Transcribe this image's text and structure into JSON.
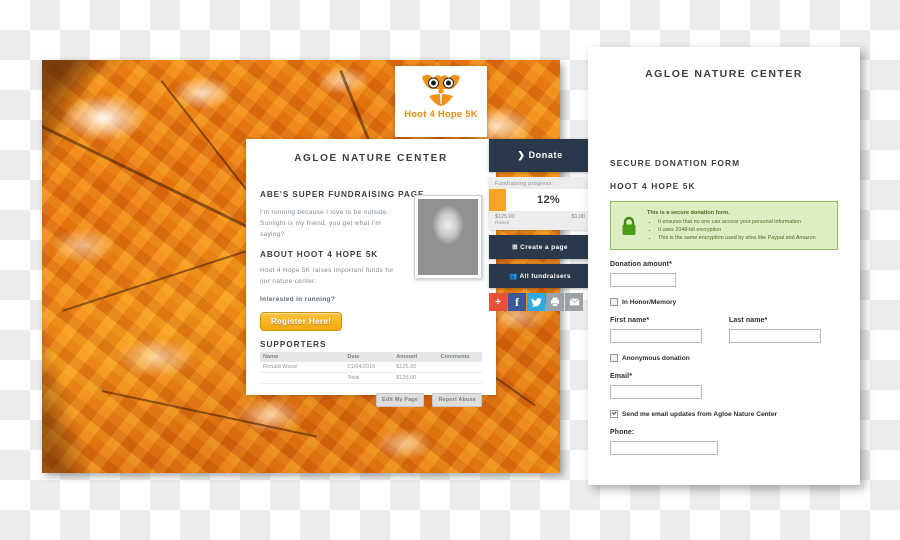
{
  "photo": {
    "alt": "autumn-maple-leaves-photo"
  },
  "logo": {
    "text": "Hoot 4 Hope 5K",
    "icon": "owl-icon"
  },
  "page": {
    "org_title": "AGLOE NATURE CENTER",
    "fundraiser_title": "ABE'S SUPER FUNDRAISING PAGE",
    "bio": "I'm running because I love to be outside. Sunlight is my friend, you get what I'm saying?",
    "about_title": "ABOUT HOOT 4 HOPE 5K",
    "about_body": "Hoot 4 Hope 5K raises important funds for our nature center.",
    "interested": "Interested in running?",
    "register_label": "Register Here!",
    "supporters_title": "SUPPORTERS",
    "supporters_columns": [
      "Name",
      "Date",
      "Amount",
      "Comments"
    ],
    "supporters_rows": [
      {
        "name": "Ronald Wood",
        "date": "01/04/2016",
        "amount": "$125.00",
        "comments": ""
      }
    ],
    "total_row": {
      "name": "",
      "date": "Total",
      "amount": "$125.00",
      "comments": ""
    },
    "edit_label": "Edit My Page",
    "report_label": "Report Abuse"
  },
  "rail": {
    "donate_label": "Donate",
    "donate_icon": "chevron-right-icon",
    "progress_label": "Fundraising progress:",
    "progress_percent": "12%",
    "raised_amount": "$125.00",
    "raised_sub": "Raised",
    "goal_amount": "$1,00",
    "create_page_label": "Create a page",
    "create_page_icon": "plus-square-icon",
    "all_fundraisers_label": "All fundraisers",
    "all_fundraisers_icon": "group-icon",
    "share": [
      {
        "name": "addthis-share-icon",
        "glyph": "+"
      },
      {
        "name": "facebook-icon",
        "glyph": "f"
      },
      {
        "name": "twitter-icon",
        "glyph": "ᵥ"
      },
      {
        "name": "print-icon",
        "glyph": "⎙"
      },
      {
        "name": "email-icon",
        "glyph": "✉"
      }
    ]
  },
  "form": {
    "org_title": "AGLOE NATURE CENTER",
    "heading": "SECURE DONATION FORM",
    "subheading": "HOOT 4 HOPE 5K",
    "secure": {
      "icon": "padlock-icon",
      "lead": "This is a secure donation form.",
      "bullets": [
        "It ensures that no one can access your personal information",
        "It uses 2048-bit encryption",
        "This is the same encryption used by sites like Paypal and Amazon"
      ]
    },
    "donation_amount_label": "Donation amount",
    "donation_amount_value": "",
    "in_honor_label": "In Honor/Memory",
    "in_honor_checked": false,
    "first_name_label": "First name",
    "first_name_value": "",
    "last_name_label": "Last name",
    "last_name_value": "",
    "anonymous_label": "Anonymous donation",
    "anonymous_checked": false,
    "email_label": "Email",
    "email_value": "",
    "updates_label": "Send me email updates from Agloe Nature Center",
    "updates_checked": true,
    "phone_label": "Phone:",
    "phone_value": "",
    "required_mark": "*"
  },
  "colors": {
    "brand_orange": "#f08a12",
    "navy": "#29384b",
    "progress_orange": "#f5a623",
    "secure_green_bg": "#ddeec2",
    "secure_green_border": "#8fbd58"
  }
}
